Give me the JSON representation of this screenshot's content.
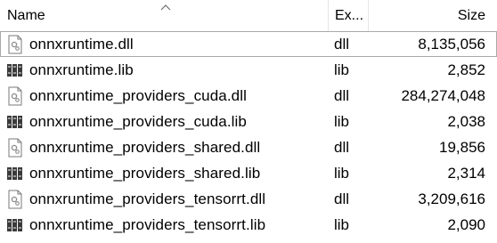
{
  "columns": {
    "name": "Name",
    "ext": "Ex...",
    "size": "Size"
  },
  "files": [
    {
      "name": "onnxruntime.dll",
      "ext": "dll",
      "size": "8,135,056",
      "icon": "dll-file-icon"
    },
    {
      "name": "onnxruntime.lib",
      "ext": "lib",
      "size": "2,852",
      "icon": "lib-file-icon"
    },
    {
      "name": "onnxruntime_providers_cuda.dll",
      "ext": "dll",
      "size": "284,274,048",
      "icon": "dll-file-icon"
    },
    {
      "name": "onnxruntime_providers_cuda.lib",
      "ext": "lib",
      "size": "2,038",
      "icon": "lib-file-icon"
    },
    {
      "name": "onnxruntime_providers_shared.dll",
      "ext": "dll",
      "size": "19,856",
      "icon": "dll-file-icon"
    },
    {
      "name": "onnxruntime_providers_shared.lib",
      "ext": "lib",
      "size": "2,314",
      "icon": "lib-file-icon"
    },
    {
      "name": "onnxruntime_providers_tensorrt.dll",
      "ext": "dll",
      "size": "3,209,616",
      "icon": "dll-file-icon"
    },
    {
      "name": "onnxruntime_providers_tensorrt.lib",
      "ext": "lib",
      "size": "2,090",
      "icon": "lib-file-icon"
    }
  ]
}
